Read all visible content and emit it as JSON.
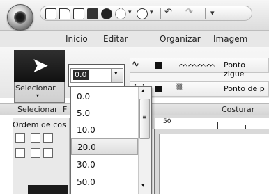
{
  "tabs": [
    "Início",
    "Editar",
    "Organizar",
    "Imagem"
  ],
  "ribbon": {
    "select_button_label": "Selecionar",
    "line_rows": [
      {
        "label": "Ponto zigue"
      },
      {
        "label": "Ponto de p"
      }
    ]
  },
  "group_labels": {
    "select": "Selecionar",
    "second": "F",
    "sew": "Costurar"
  },
  "left_pane": {
    "title": "Ordem de cos"
  },
  "combo": {
    "value": "0.0"
  },
  "dropdown": {
    "options": [
      "0.0",
      "5.0",
      "10.0",
      "20.0",
      "30.0",
      "50.0"
    ],
    "highlighted": "20.0"
  },
  "ruler": {
    "first_tick": "50"
  },
  "colors": {
    "accent": "#595959"
  }
}
